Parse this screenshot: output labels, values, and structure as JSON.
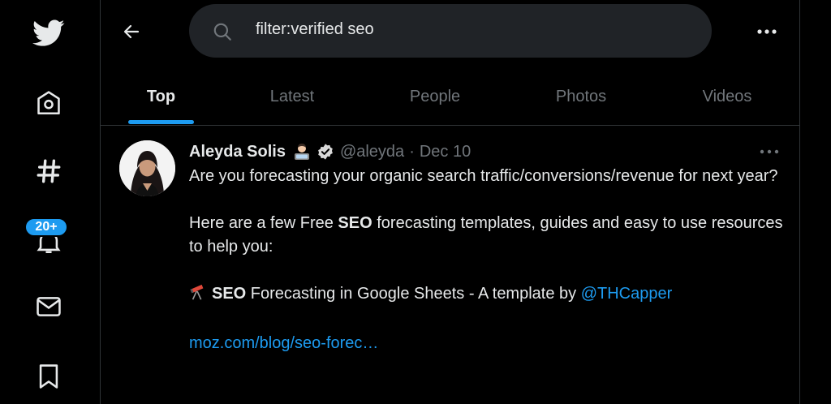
{
  "nav": {
    "items": [
      {
        "icon": "twitter-bird-icon"
      },
      {
        "icon": "home-icon"
      },
      {
        "icon": "explore-hashtag-icon"
      },
      {
        "icon": "notifications-bell-icon",
        "badge": "20+"
      },
      {
        "icon": "messages-envelope-icon"
      },
      {
        "icon": "bookmarks-icon"
      }
    ]
  },
  "header": {
    "back_icon": "back-arrow-icon",
    "search": {
      "icon": "search-icon",
      "value": "filter:verified seo"
    },
    "more_icon": "more-horizontal-icon"
  },
  "tabs": [
    {
      "label": "Top",
      "active": true
    },
    {
      "label": "Latest",
      "active": false
    },
    {
      "label": "People",
      "active": false
    },
    {
      "label": "Photos",
      "active": false
    },
    {
      "label": "Videos",
      "active": false
    }
  ],
  "tweet": {
    "author_name": "Aleyda Solis",
    "author_emoji": "technologist-emoji",
    "verified_icon": "verified-badge-icon",
    "handle": "@aleyda",
    "separator": "·",
    "date": "Dec 10",
    "more_icon": "more-horizontal-icon",
    "para1": "Are you forecasting your organic search traffic/conversions/revenue for next year?",
    "para2_prefix": "Here are a few Free ",
    "para2_bold": "SEO",
    "para2_suffix": " forecasting templates, guides and easy to use resources to help you:",
    "item_icon": "telescope-emoji",
    "item_bold": "SEO",
    "item_text": " Forecasting in Google Sheets - A template by ",
    "item_mention": "@THCapper",
    "link": "moz.com/blog/seo-forec…"
  },
  "colors": {
    "background": "#000000",
    "accent": "#1d9bf0",
    "text": "#e7e9ea",
    "muted": "#71767b",
    "search_bg": "#202327"
  }
}
